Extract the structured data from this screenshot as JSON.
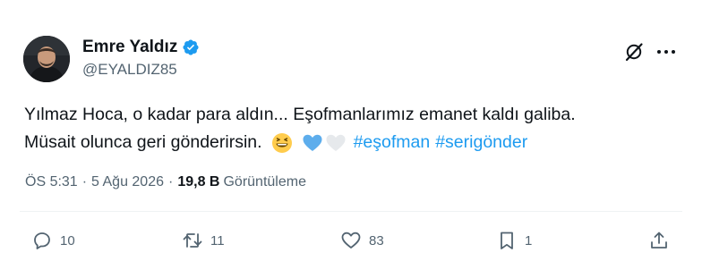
{
  "author": {
    "display_name": "Emre Yaldız",
    "handle": "@EYALDIZ85",
    "verified": true
  },
  "tweet": {
    "line1": "Yılmaz Hoca, o kadar para aldın... Eşofmanlarımız emanet kaldı galiba.",
    "line2_text": "Müsait olunca geri gönderirsin.",
    "emojis": [
      "grinning-squinting-face",
      "blue-heart",
      "white-heart"
    ],
    "hashtags": [
      "#eşofman",
      "#serigönder"
    ]
  },
  "meta": {
    "time": "ÖS 5:31",
    "date": "5 Ağu 2026",
    "views_count": "19,8 B",
    "views_label": "Görüntüleme",
    "separator": "·"
  },
  "actions": {
    "replies": "10",
    "retweets": "11",
    "likes": "83",
    "bookmarks": "1"
  },
  "colors": {
    "text": "#0f1419",
    "secondary": "#536471",
    "accent": "#1d9bf0",
    "divider": "#eff3f4"
  }
}
